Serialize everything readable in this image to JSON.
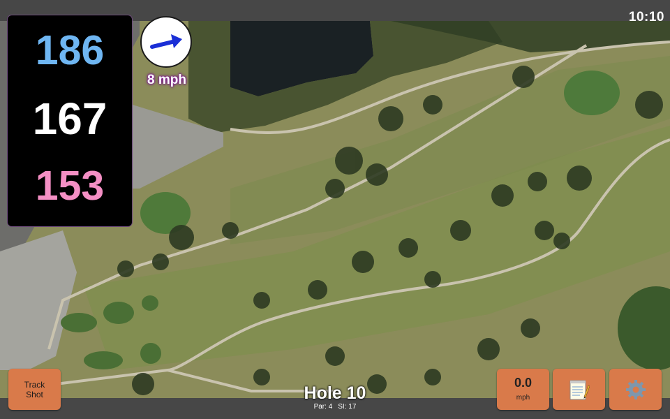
{
  "status": {
    "time": "10:10"
  },
  "distances": {
    "back": "186",
    "center": "167",
    "front": "153"
  },
  "colors": {
    "back": "#6fb6f2",
    "center": "#ffffff",
    "front": "#f48fc4",
    "button": "#d97a4a",
    "wind_arrow": "#1a2fd6"
  },
  "wind": {
    "speed_label": "8 mph",
    "arrow_icon": "wind-direction-arrow-icon"
  },
  "buttons": {
    "track_shot": {
      "line1": "Track",
      "line2": "Shot"
    },
    "speed": {
      "value": "0.0",
      "unit": "mph"
    },
    "notes": {
      "icon": "notepad-icon"
    },
    "settings": {
      "icon": "gear-icon"
    }
  },
  "hole": {
    "title": "Hole 10",
    "par_label": "Par: 4",
    "si_label": "SI: 17"
  }
}
